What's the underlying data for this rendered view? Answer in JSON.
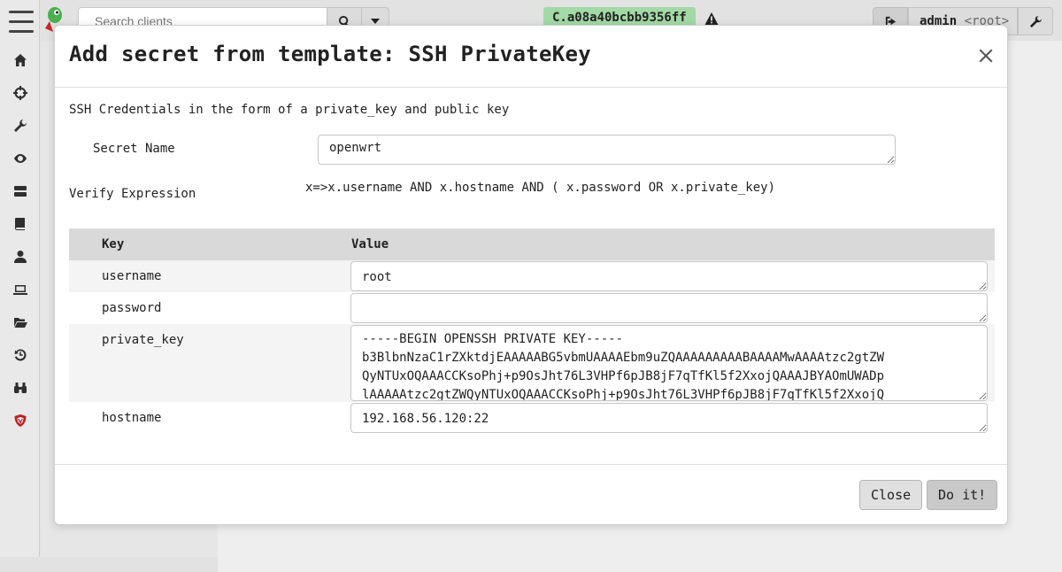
{
  "app": {
    "search_placeholder": "Search clients",
    "client_id": "C.a08a40bcbb9356ff",
    "user": "admin",
    "user_role": "<root>"
  },
  "sidebar": {
    "icons": [
      "home-icon",
      "crosshair-icon",
      "wrench-icon",
      "eye-icon",
      "server-icon",
      "book-icon",
      "user-icon",
      "laptop-icon",
      "folder-open-icon",
      "history-icon",
      "binoculars-icon",
      "shield-icon"
    ]
  },
  "modal": {
    "title": "Add secret from template: SSH PrivateKey",
    "description": "SSH Credentials in the form of a private_key and public key",
    "secret_name_label": "Secret Name",
    "secret_name_value": "openwrt",
    "verify_label": "Verify Expression",
    "verify_expression": "x=>x.username AND x.hostname AND ( x.password OR x.private_key)",
    "table": {
      "headers": {
        "key": "Key",
        "value": "Value"
      },
      "rows": [
        {
          "key": "username",
          "value": "root"
        },
        {
          "key": "password",
          "value": ""
        },
        {
          "key": "private_key",
          "value": "-----BEGIN OPENSSH PRIVATE KEY-----\nb3BlbnNzaC1rZXktdjEAAAAABG5vbmUAAAAEbm9uZQAAAAAAAAABAAAAMwAAAAtzc2gtZW\nQyNTUxOQAAACCKsoPhj+p9OsJht76L3VHPf6pJB8jF7qTfKl5f2XxojQAAAJBYAOmUWADp\nlAAAAAtzc2gtZWQyNTUxOQAAACCKsoPhj+p9OsJht76L3VHPf6pJB8jF7qTfKl5f2XxojQ"
        },
        {
          "key": "hostname",
          "value": "192.168.56.120:22"
        }
      ]
    },
    "buttons": {
      "close": "Close",
      "submit": "Do it!"
    }
  }
}
